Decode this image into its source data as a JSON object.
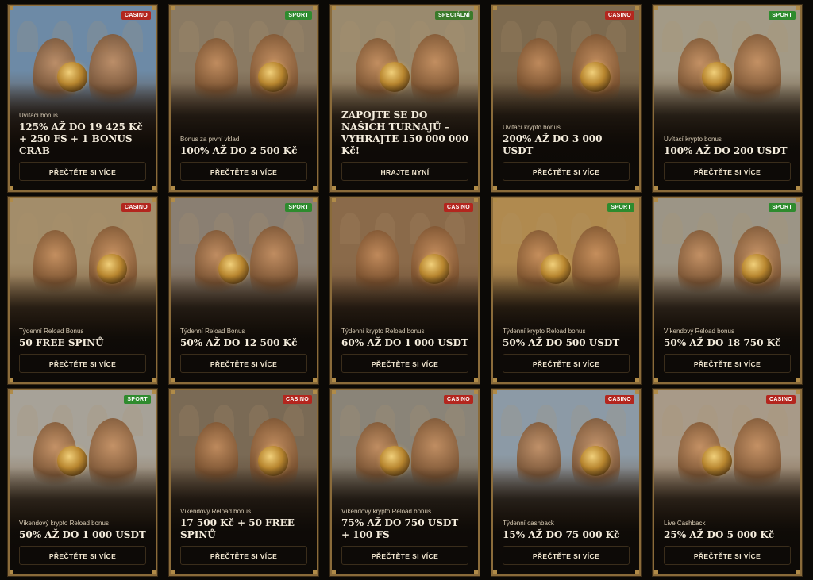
{
  "cards": [
    {
      "tag": "CASINO",
      "tag_type": "casino",
      "subtitle": "Uvítací bonus",
      "title": "125% AŽ DO 19 425 Kč + 250 FS + 1 BONUS CRAB",
      "button": "PŘEČTĚTE SI VÍCE",
      "sky": "#6d8aa6",
      "ground": "#5a3a22"
    },
    {
      "tag": "SPORT",
      "tag_type": "sport",
      "subtitle": "Bonus za první vklad",
      "title": "100% AŽ DO 2 500 Kč",
      "button": "PŘEČTĚTE SI VÍCE",
      "sky": "#8a7a63",
      "ground": "#4a3220"
    },
    {
      "tag": "SPECIÁLNÍ",
      "tag_type": "special",
      "subtitle": "",
      "title": "ZAPOJTE SE DO NAŠICH TURNAJŮ – VYHRAJTE 150 000 000 Kč!",
      "button": "HRAJTE NYNÍ",
      "sky": "#9a8a6e",
      "ground": "#5c4128"
    },
    {
      "tag": "CASINO",
      "tag_type": "casino",
      "subtitle": "Uvítací krypto bonus",
      "title": "200% AŽ DO 3 000 USDT",
      "button": "PŘEČTĚTE SI VÍCE",
      "sky": "#7d6a4f",
      "ground": "#3e2a18"
    },
    {
      "tag": "SPORT",
      "tag_type": "sport",
      "subtitle": "Uvítací krypto bonus",
      "title": "100% AŽ DO 200 USDT",
      "button": "PŘEČTĚTE SI VÍCE",
      "sky": "#a39a86",
      "ground": "#5a4128"
    },
    {
      "tag": "CASINO",
      "tag_type": "casino",
      "subtitle": "Týdenní Reload Bonus",
      "title": "50 FREE SPINŮ",
      "button": "PŘEČTĚTE SI VÍCE",
      "sky": "#a38d6a",
      "ground": "#6b4a2b"
    },
    {
      "tag": "SPORT",
      "tag_type": "sport",
      "subtitle": "Týdenní Reload Bonus",
      "title": "50% AŽ DO 12 500 Kč",
      "button": "PŘEČTĚTE SI VÍCE",
      "sky": "#8a7f72",
      "ground": "#5a3f26"
    },
    {
      "tag": "CASINO",
      "tag_type": "casino",
      "subtitle": "Týdenní krypto Reload bonus",
      "title": "60% AŽ DO 1 000 USDT",
      "button": "PŘEČTĚTE SI VÍCE",
      "sky": "#8a6a4a",
      "ground": "#5d4028"
    },
    {
      "tag": "SPORT",
      "tag_type": "sport",
      "subtitle": "Týdenní krypto Reload bonus",
      "title": "50% AŽ DO 500 USDT",
      "button": "PŘEČTĚTE SI VÍCE",
      "sky": "#b08a4f",
      "ground": "#4d3520"
    },
    {
      "tag": "SPORT",
      "tag_type": "sport",
      "subtitle": "Víkendový Reload bonus",
      "title": "50% AŽ DO 18 750 Kč",
      "button": "PŘEČTĚTE SI VÍCE",
      "sky": "#9c9586",
      "ground": "#6a4b2e"
    },
    {
      "tag": "SPORT",
      "tag_type": "sport",
      "subtitle": "Víkendový krypto Reload bonus",
      "title": "50% AŽ DO 1 000 USDT",
      "button": "PŘEČTĚTE SI VÍCE",
      "sky": "#a7a298",
      "ground": "#7a5a38"
    },
    {
      "tag": "CASINO",
      "tag_type": "casino",
      "subtitle": "Víkendový Reload bonus",
      "title": "17 500 Kč + 50 FREE SPINŮ",
      "button": "PŘEČTĚTE SI VÍCE",
      "sky": "#7a6a55",
      "ground": "#4a3524"
    },
    {
      "tag": "CASINO",
      "tag_type": "casino",
      "subtitle": "Víkendový krypto Reload bonus",
      "title": "75% AŽ DO 750 USDT + 100 FS",
      "button": "PŘEČTĚTE SI VÍCE",
      "sky": "#8a8478",
      "ground": "#4e3a26"
    },
    {
      "tag": "CASINO",
      "tag_type": "casino",
      "subtitle": "Týdenní cashback",
      "title": "15% AŽ DO 75 000 Kč",
      "button": "PŘEČTĚTE SI VÍCE",
      "sky": "#8c9aa6",
      "ground": "#6a4c30"
    },
    {
      "tag": "CASINO",
      "tag_type": "casino",
      "subtitle": "Live Cashback",
      "title": "25% AŽ DO 5 000 Kč",
      "button": "PŘEČTĚTE SI VÍCE",
      "sky": "#a89a88",
      "ground": "#6b4d30"
    }
  ]
}
